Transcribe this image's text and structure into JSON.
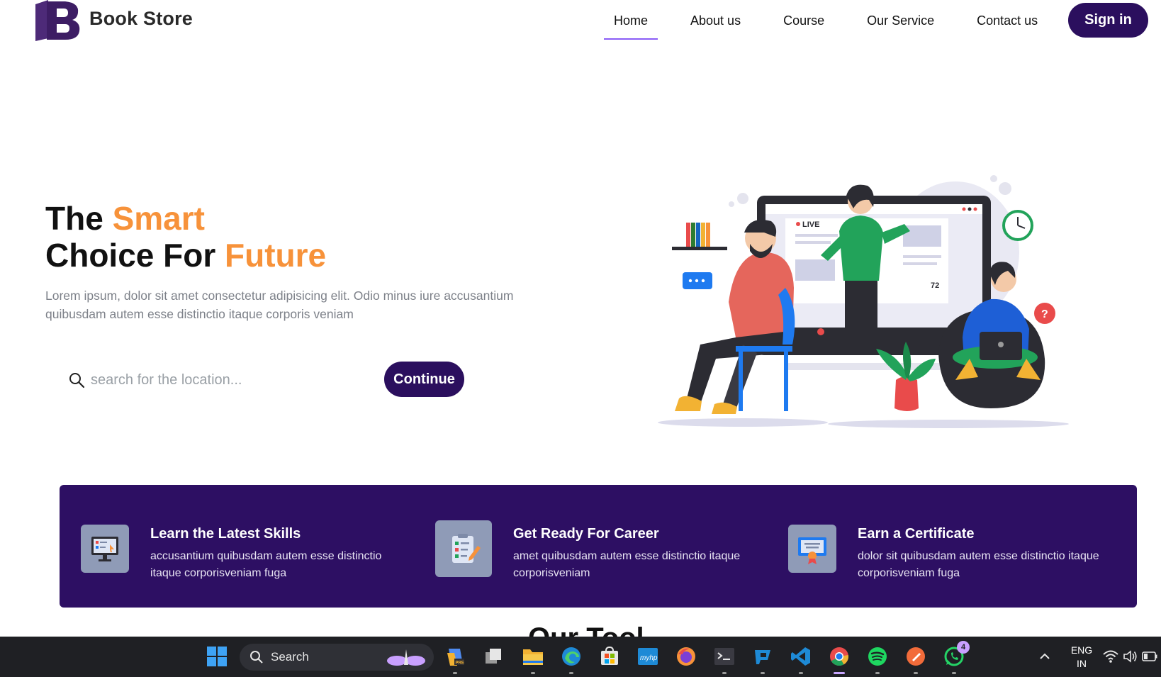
{
  "brand": {
    "name": "Book Store",
    "letter": "B",
    "color": "#3d1d64"
  },
  "nav": {
    "items": [
      {
        "label": "Home",
        "active": true
      },
      {
        "label": "About us",
        "active": false
      },
      {
        "label": "Course",
        "active": false
      },
      {
        "label": "Our Service",
        "active": false
      },
      {
        "label": "Contact us",
        "active": false
      }
    ],
    "signin_label": "Sign in"
  },
  "hero": {
    "title_line1_prefix": "The ",
    "title_line1_accent": "Smart",
    "title_line2_prefix": "Choice For ",
    "title_line2_accent": "Future",
    "description": "Lorem ipsum, dolor sit amet consectetur adipisicing elit. Odio minus iure accusantium quibusdam autem esse distinctio itaque corporis veniam",
    "search_placeholder": "search for the location...",
    "continue_label": "Continue",
    "illustration": {
      "live_label": "LIVE",
      "viewer_count": "72"
    }
  },
  "features": [
    {
      "icon": "computer-screen-icon",
      "title": "Learn the Latest Skills",
      "text": "accusantium quibusdam autem esse distinctio itaque corporisveniam fuga"
    },
    {
      "icon": "checklist-icon",
      "title": "Get Ready For Career",
      "text": "amet quibusdam autem esse distinctio itaque corporisveniam"
    },
    {
      "icon": "certificate-icon",
      "title": "Earn a Certificate",
      "text": "dolor sit quibusdam autem esse distinctio itaque corporisveniam fuga"
    }
  ],
  "next_section_heading_partial": "Our Tool",
  "taskbar": {
    "search_label": "Search",
    "whatsapp_badge": "4",
    "language": "ENG",
    "region": "IN"
  },
  "colors": {
    "primary": "#2b0f5e",
    "accent": "#f7923a",
    "band": "#2d0f63",
    "nav_underline": "#8a5cf6"
  }
}
